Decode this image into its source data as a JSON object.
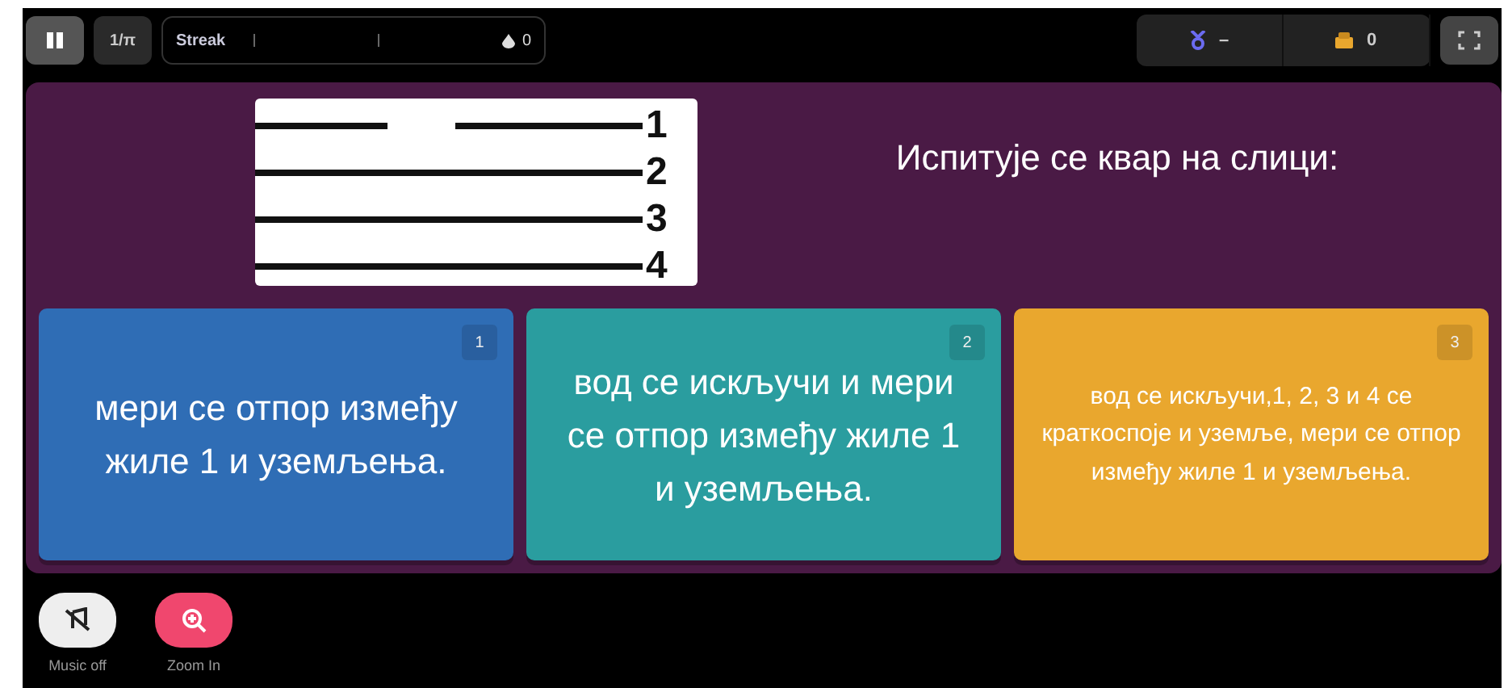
{
  "top_bar": {
    "pause": {
      "selected": true
    },
    "speed": "1/π",
    "streak": {
      "label": "Streak",
      "count": "0"
    },
    "medals": "–",
    "coins": "0"
  },
  "question": {
    "image_labels": [
      "1",
      "2",
      "3",
      "4"
    ],
    "text": "Испитује се квар на слици:"
  },
  "answers": [
    {
      "number": "1",
      "text": "мери се отпор између жиле 1 и уземљења.",
      "color": "#2f6db5",
      "kind": "short"
    },
    {
      "number": "2",
      "text": "вод се искључи и мери се отпор између жиле 1 и уземљења.",
      "color": "#2a9d9f",
      "kind": "short"
    },
    {
      "number": "3",
      "text": "вод се искључи,1, 2, 3 и 4 се краткоспоје и уземље, мери се отпор између жиле 1 и уземљења.",
      "color": "#e9a72e",
      "kind": "long"
    }
  ],
  "controls": [
    {
      "label": "Music off",
      "kind": "music"
    },
    {
      "label": "Zoom In",
      "kind": "zoom"
    }
  ]
}
